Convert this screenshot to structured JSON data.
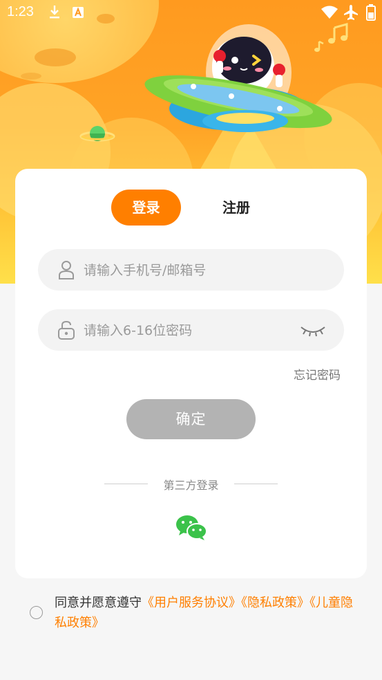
{
  "status_bar": {
    "time": "1:23"
  },
  "auth_tabs": {
    "login_label": "登录",
    "register_label": "注册"
  },
  "form": {
    "account_placeholder": "请输入手机号/邮箱号",
    "account_value": "",
    "password_placeholder": "请输入6-16位密码",
    "password_value": "",
    "forgot_label": "忘记密码",
    "confirm_label": "确定"
  },
  "third_party": {
    "title": "第三方登录",
    "providers": [
      "wechat-icon"
    ]
  },
  "agreement": {
    "prefix": "同意并愿意遵守",
    "links": [
      "《用户服务协议》",
      "《隐私政策》",
      "《儿童隐私政策》"
    ]
  },
  "colors": {
    "accent": "#ff7f00",
    "disabled_button": "#b3b3b3",
    "wechat_green": "#3bc24a"
  },
  "icons": {
    "status_left": [
      "download-icon",
      "a-badge-icon"
    ],
    "status_right": [
      "wifi-icon",
      "airplane-icon",
      "battery-icon"
    ],
    "account_field": "user-icon",
    "password_field": "unlock-icon",
    "password_toggle": "eye-closed-icon"
  }
}
